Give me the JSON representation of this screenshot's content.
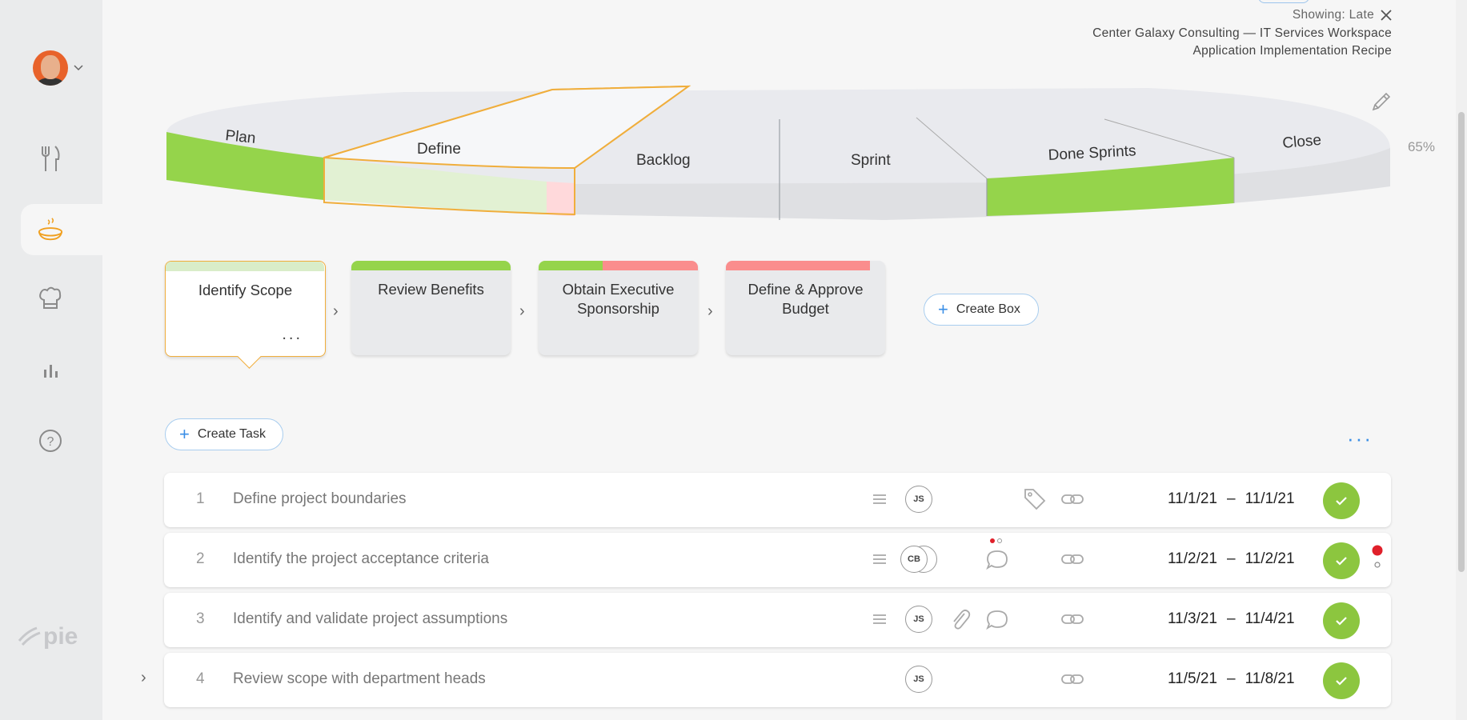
{
  "header": {
    "showing_label": "Showing: Late",
    "workspace": "Center Galaxy Consulting — IT Services Workspace",
    "recipe": "Application Implementation Recipe"
  },
  "pie": {
    "phases": [
      "Plan",
      "Define",
      "Backlog",
      "Sprint",
      "Done Sprints",
      "Close"
    ],
    "percent": "65%",
    "colors": {
      "done": "#95d44b",
      "in_progress": "#e2f1d3",
      "late": "#ffd9db",
      "empty": "#dfe0e3",
      "selected_outline": "#f0ae3c"
    }
  },
  "boxes": [
    {
      "title": "Identify Scope",
      "selected": true,
      "progress_bar": [
        {
          "color": "#d9edc9",
          "fraction": 1.0
        }
      ]
    },
    {
      "title": "Review Benefits",
      "selected": false,
      "progress_bar": [
        {
          "color": "#95d44b",
          "fraction": 1.0
        }
      ]
    },
    {
      "title": "Obtain Executive Sponsorship",
      "selected": false,
      "progress_bar": [
        {
          "color": "#95d44b",
          "fraction": 0.4
        },
        {
          "color": "#fa8d8d",
          "fraction": 0.6
        }
      ]
    },
    {
      "title": "Define & Approve Budget",
      "selected": false,
      "progress_bar": [
        {
          "color": "#fa8d8d",
          "fraction": 0.9
        }
      ]
    }
  ],
  "buttons": {
    "create_box": "Create Box",
    "create_task": "Create Task",
    "box_more": "..."
  },
  "tasks": [
    {
      "num": "1",
      "name": "Define project boundaries",
      "assignee": "JS",
      "start": "11/1/21",
      "end": "11/1/21"
    },
    {
      "num": "2",
      "name": "Identify the project acceptance criteria",
      "assignee": "CB",
      "start": "11/2/21",
      "end": "11/2/21"
    },
    {
      "num": "3",
      "name": "Identify and validate project assumptions",
      "assignee": "JS",
      "start": "11/3/21",
      "end": "11/4/21"
    },
    {
      "num": "4",
      "name": "Review scope with department heads",
      "assignee": "JS",
      "start": "11/5/21",
      "end": "11/8/21"
    }
  ],
  "date_separator": "–",
  "brand": {
    "logo_text": "pie",
    "accent": "#3a8ee6",
    "complete": "#8cc63f"
  }
}
